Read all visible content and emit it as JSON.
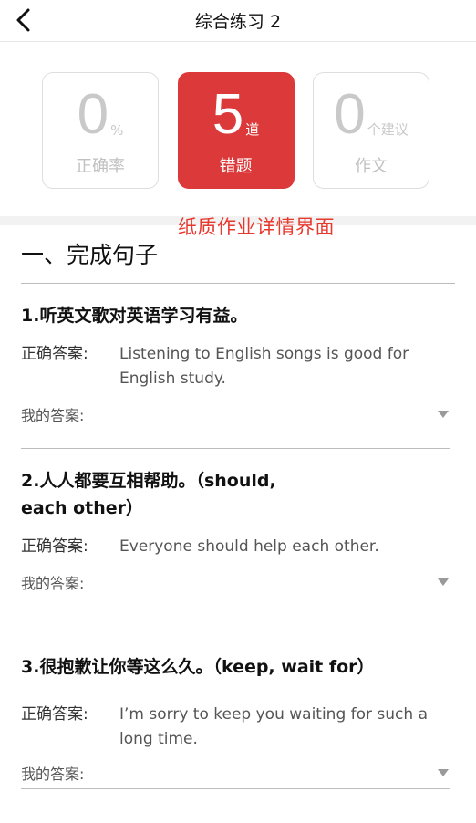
{
  "header": {
    "title": "综合练习 2"
  },
  "stats": [
    {
      "number": "0",
      "unit": "%",
      "label": "正确率"
    },
    {
      "number": "5",
      "unit": "道",
      "label": "错题"
    },
    {
      "number": "0",
      "unit": "个建议",
      "label": "作文"
    }
  ],
  "annotation": "纸质作业详情界面",
  "section_title": "一、完成句子",
  "answer_labels": {
    "correct": "正确答案:",
    "mine": "我的答案:"
  },
  "questions": [
    {
      "text": "1.听英文歌对英语学习有益。",
      "answer": "Listening to English songs is good for English study."
    },
    {
      "text": "2.人人都要互相帮助。（should, each other）",
      "answer": "Everyone should help each other."
    },
    {
      "text": "3.很抱歉让你等这么久。（keep, wait for）",
      "answer": "I’m sorry to keep you waiting for such a long time."
    }
  ],
  "colors": {
    "accent": "#dc3a3a",
    "annotation": "#e8392f"
  }
}
